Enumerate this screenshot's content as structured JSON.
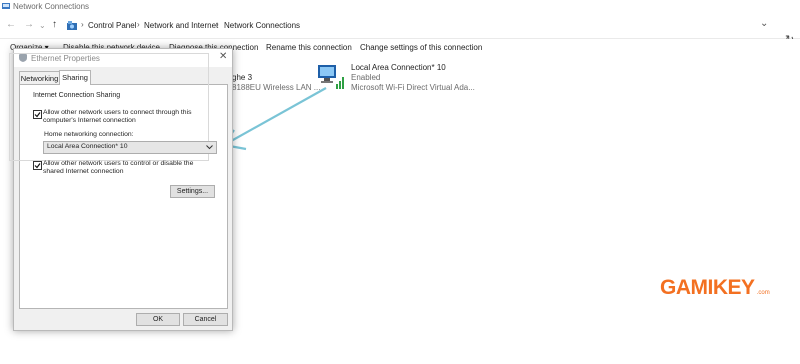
{
  "window": {
    "title": "Network Connections"
  },
  "address": {
    "breadcrumbs": [
      "Control Panel",
      "Network and Internet",
      "Network Connections"
    ]
  },
  "commands": {
    "organize": "Organize ▾",
    "disable": "Disable this network device",
    "diagnose": "Diagnose this connection",
    "rename": "Rename this connection",
    "change": "Change settings of this connection"
  },
  "connections": [
    {
      "name": "Local Area Connection* 10",
      "status": "Enabled",
      "adapter": "Microsoft Wi-Fi Direct Virtual Ada..."
    },
    {
      "partial_name": "ghe 3",
      "partial_adapter": "8188EU Wireless LAN ..."
    }
  ],
  "dialog": {
    "title": "Ethernet Properties",
    "tabs": [
      "Networking",
      "Sharing"
    ],
    "active_tab": "Sharing",
    "group_title": "Internet Connection Sharing",
    "allow_connect_line1": "Allow other network users to connect through this",
    "allow_connect_line2": "computer's Internet connection",
    "home_label": "Home networking connection:",
    "home_value": "Local Area Connection* 10",
    "allow_control_line1": "Allow other network users to control or disable the",
    "allow_control_line2": "shared Internet connection",
    "settings_label": "Settings...",
    "ok_label": "OK",
    "cancel_label": "Cancel"
  },
  "watermark": {
    "brand": "GAMIKEY",
    "suffix": ".com"
  },
  "colors": {
    "arrow": "#7ac4d6",
    "brand": "#f37021",
    "accent": "#0a64ad"
  },
  "icons": [
    "window-icon",
    "back-icon",
    "forward-icon",
    "up-icon",
    "network-folder-icon",
    "refresh-icon",
    "network-adapter-icon",
    "shield-icon",
    "close-icon",
    "dropdown-arrow-icon",
    "checkbox-icon"
  ]
}
